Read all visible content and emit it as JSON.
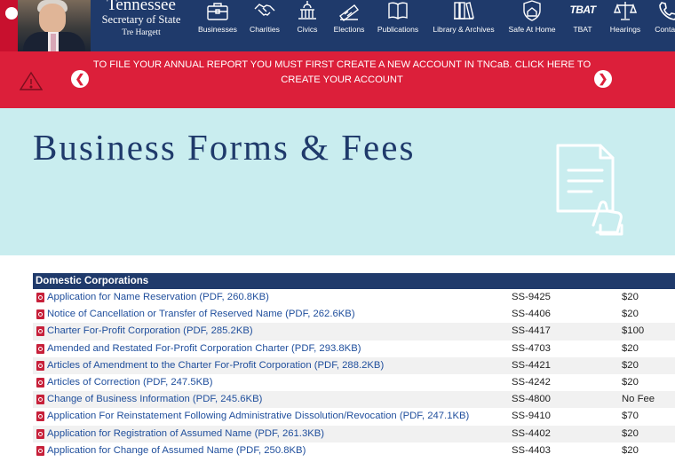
{
  "brand": {
    "name": "Tennessee",
    "office": "Secretary of State",
    "official": "Tre Hargett"
  },
  "nav": [
    {
      "label": "Businesses",
      "icon": "briefcase-icon"
    },
    {
      "label": "Charities",
      "icon": "handshake-icon"
    },
    {
      "label": "Civics",
      "icon": "capitol-icon"
    },
    {
      "label": "Elections",
      "icon": "ballot-icon"
    },
    {
      "label": "Publications",
      "icon": "book-icon"
    },
    {
      "label": "Library & Archives",
      "icon": "books-icon"
    },
    {
      "label": "Safe At Home",
      "icon": "shield-home-icon"
    },
    {
      "label": "TBAT",
      "icon": "tbat-logo-icon",
      "logo_text": "TBAT"
    },
    {
      "label": "Hearings",
      "icon": "scales-icon"
    },
    {
      "label": "Contact",
      "icon": "phone-icon"
    }
  ],
  "alert": {
    "message": "TO FILE YOUR ANNUAL REPORT YOU MUST FIRST CREATE A NEW ACCOUNT IN TNCaB. CLICK HERE TO CREATE YOUR ACCOUNT",
    "prev_glyph": "❮",
    "next_glyph": "❯"
  },
  "hero": {
    "title": "Business Forms & Fees"
  },
  "table": {
    "heading": "Domestic Corporations",
    "rows": [
      {
        "title": "Application for Name Reservation (PDF, 260.8KB)",
        "number": "SS-9425",
        "fee": "$20"
      },
      {
        "title": "Notice of Cancellation or Transfer of Reserved Name (PDF, 262.6KB)",
        "number": "SS-4406",
        "fee": "$20"
      },
      {
        "title": "Charter For-Profit Corporation (PDF, 285.2KB)",
        "number": "SS-4417",
        "fee": "$100"
      },
      {
        "title": "Amended and Restated For-Profit Corporation Charter (PDF, 293.8KB)",
        "number": "SS-4703",
        "fee": "$20"
      },
      {
        "title": "Articles of Amendment to the Charter For-Profit Corporation (PDF, 288.2KB)",
        "number": "SS-4421",
        "fee": "$20"
      },
      {
        "title": "Articles of Correction (PDF, 247.5KB)",
        "number": "SS-4242",
        "fee": "$20"
      },
      {
        "title": "Change of Business Information (PDF, 245.6KB)",
        "number": "SS-4800",
        "fee": "No Fee"
      },
      {
        "title": "Application For Reinstatement Following Administrative Dissolution/Revocation (PDF, 247.1KB)",
        "number": "SS-9410",
        "fee": "$70"
      },
      {
        "title": "Application for Registration of Assumed Name (PDF, 261.3KB)",
        "number": "SS-4402",
        "fee": "$20"
      },
      {
        "title": "Application for Change of Assumed Name (PDF, 250.8KB)",
        "number": "SS-4403",
        "fee": "$20"
      }
    ]
  },
  "colors": {
    "navy": "#1f3a6b",
    "alert_red": "#dc1f3a",
    "hero_bg": "#c9edef",
    "link": "#1f4e9c",
    "pdf_red": "#c7203a"
  }
}
